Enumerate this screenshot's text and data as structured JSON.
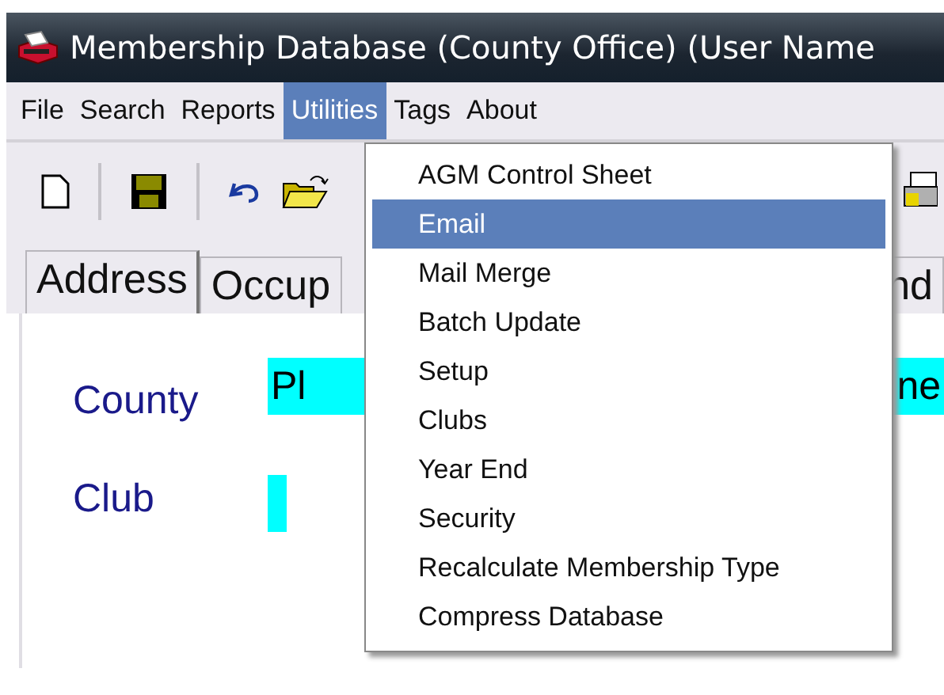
{
  "window": {
    "title": "Membership Database (County Office) (User Name"
  },
  "menu_bar": [
    {
      "label": "File",
      "selected": false
    },
    {
      "label": "Search",
      "selected": false
    },
    {
      "label": "Reports",
      "selected": false
    },
    {
      "label": "Utilities",
      "selected": true
    },
    {
      "label": "Tags",
      "selected": false
    },
    {
      "label": "About",
      "selected": false
    }
  ],
  "utilities_menu": [
    {
      "label": "AGM Control Sheet",
      "selected": false
    },
    {
      "label": "Email",
      "selected": true
    },
    {
      "label": "Mail Merge",
      "selected": false
    },
    {
      "label": "Batch Update",
      "selected": false
    },
    {
      "label": "Setup",
      "selected": false
    },
    {
      "label": "Clubs",
      "selected": false
    },
    {
      "label": "Year End",
      "selected": false
    },
    {
      "label": "Security",
      "selected": false
    },
    {
      "label": "Recalculate Membership Type",
      "selected": false
    },
    {
      "label": "Compress Database",
      "selected": false
    }
  ],
  "tabs": [
    {
      "label": "Address",
      "selected": true
    },
    {
      "label": "Occup",
      "selected": false
    },
    {
      "label": "nd",
      "selected": false
    }
  ],
  "form": {
    "county": {
      "label": "County",
      "value_start": "Pl",
      "value_end": "ne"
    },
    "club": {
      "label": "Club"
    }
  }
}
